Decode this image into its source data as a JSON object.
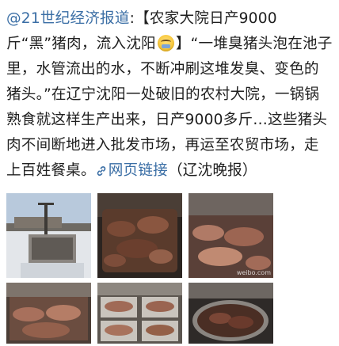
{
  "post": {
    "author_handle": "@21世纪经济报道",
    "colon": ":",
    "text_part1": "【农家大院日产9000斤“黑”猪肉，流入沈阳",
    "emoji_name": "crying-face-emoji",
    "text_part2": "】“一堆臭猪头泡在池子里，水管流出的水，不断冲刷这堆发臭、变色的猪头。”在辽宁沈阳一处破旧的农村大院，一锅锅熟食就这样生产出来，日产9000多斤…这些猪头肉不间断地进入批发市场，再运至农贸市场，走上百姓餐桌。",
    "link_icon": "link-icon",
    "link_text": "网页链接",
    "source": "（辽沈晚报）"
  },
  "photos": {
    "watermark_3": "weibo.com"
  },
  "colors": {
    "link": "#3a6ea5",
    "text": "#1f1f1f",
    "background": "#ffffff"
  }
}
